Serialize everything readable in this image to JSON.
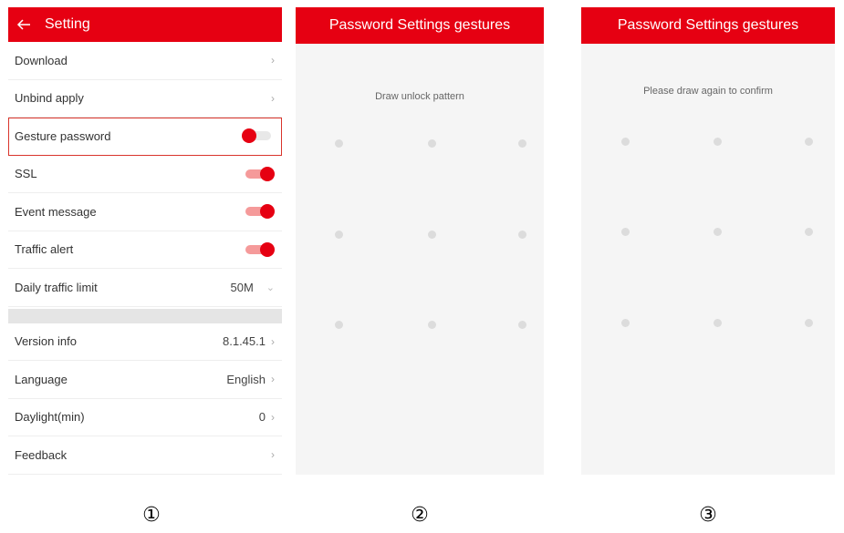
{
  "screen1": {
    "title": "Setting",
    "rows": [
      {
        "label": "Download",
        "chevron": "›"
      },
      {
        "label": "Unbind apply",
        "chevron": "›"
      },
      {
        "label": "Gesture password",
        "toggle": "off",
        "highlighted": true
      },
      {
        "label": "SSL",
        "toggle": "on"
      },
      {
        "label": "Event message",
        "toggle": "on"
      },
      {
        "label": "Traffic alert",
        "toggle": "on"
      },
      {
        "label": "Daily traffic limit",
        "value": "50M",
        "caret": "⌄"
      }
    ],
    "rows2": [
      {
        "label": "Version info",
        "value": "8.1.45.1",
        "chevron": "›"
      },
      {
        "label": "Language",
        "value": "English",
        "chevron": "›"
      },
      {
        "label": "Daylight(min)",
        "value": "0",
        "chevron": "›"
      },
      {
        "label": "Feedback",
        "chevron": "›"
      }
    ]
  },
  "screen2": {
    "title": "Password Settings gestures",
    "prompt": "Draw unlock pattern"
  },
  "screen3": {
    "title": "Password Settings gestures",
    "prompt": "Please draw again to confirm"
  },
  "labels": [
    "①",
    "②",
    "③"
  ],
  "colors": {
    "accent": "#e60012",
    "highlight": "#d9342b",
    "dot": "#dcdcdc"
  }
}
